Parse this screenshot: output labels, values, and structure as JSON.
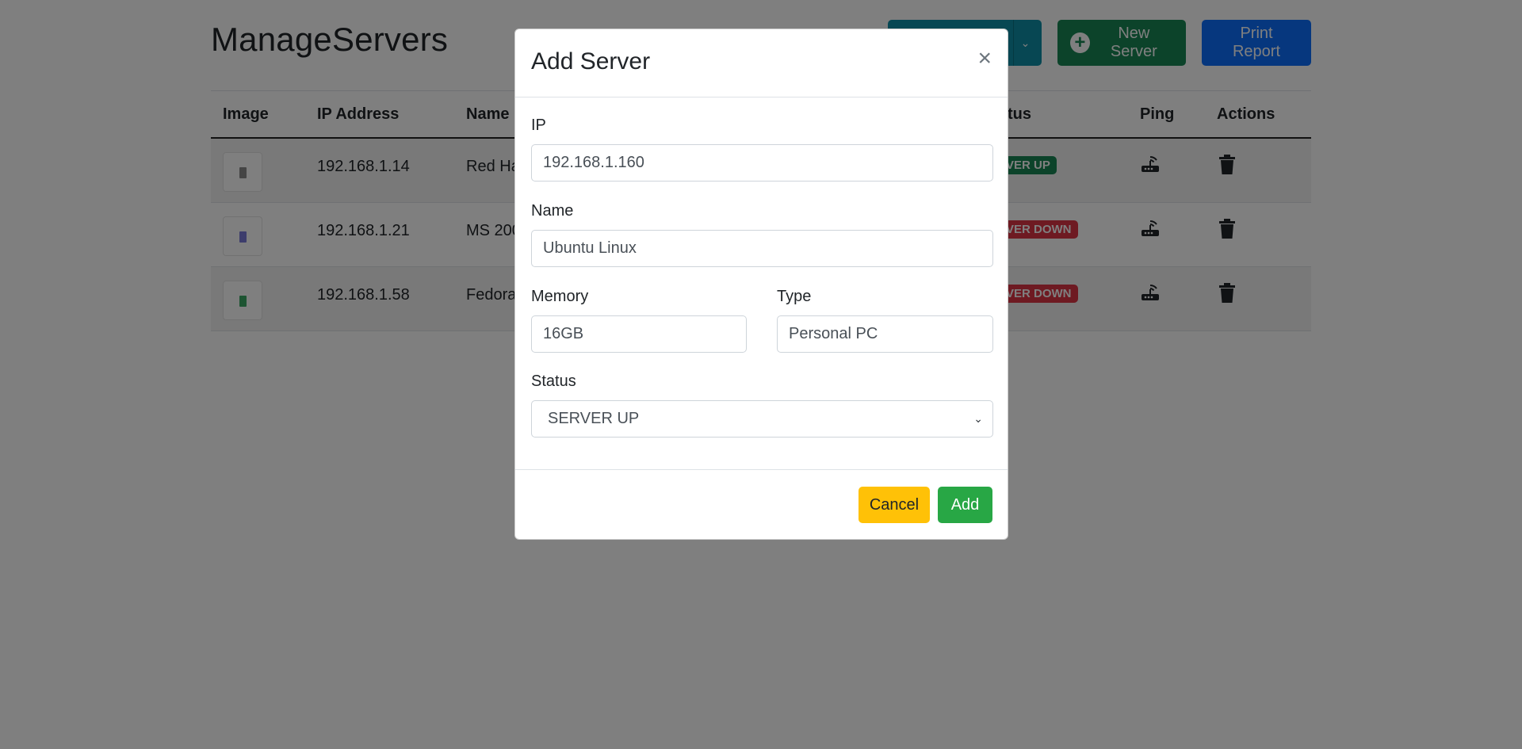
{
  "app": {
    "title": "ManageServers"
  },
  "toolbar": {
    "filter_label": "",
    "new_server_label": "New Server",
    "print_label": "Print Report"
  },
  "table": {
    "headers": [
      "Image",
      "IP Address",
      "Name",
      "",
      "Status",
      "Ping",
      "Actions"
    ],
    "rows": [
      {
        "ip": "192.168.1.14",
        "name": "Red Ha",
        "status": "VER UP",
        "status_color": "#198754",
        "thumb_color": "#8a8a8a"
      },
      {
        "ip": "192.168.1.21",
        "name": "MS 200",
        "status": "VER DOWN",
        "status_color": "#dc3545",
        "thumb_color": "#7b7bd9"
      },
      {
        "ip": "192.168.1.58",
        "name": "Fedora",
        "status": "VER DOWN",
        "status_color": "#dc3545",
        "thumb_color": "#3aa864"
      }
    ],
    "status_header_visible": "tus"
  },
  "modal": {
    "title": "Add Server",
    "close_icon": "×",
    "ip_label": "IP",
    "ip_value": "192.168.1.160",
    "name_label": "Name",
    "name_value": "Ubuntu Linux",
    "memory_label": "Memory",
    "memory_value": "16GB",
    "type_label": "Type",
    "type_value": "Personal PC",
    "status_label": "Status",
    "status_value": "SERVER UP",
    "cancel_label": "Cancel",
    "add_label": "Add"
  },
  "colors": {
    "filter_btn": "#0e8fa6",
    "new_btn": "#198754",
    "print_btn": "#0d6efd",
    "cancel_btn": "#ffc107",
    "add_btn": "#28a745"
  }
}
